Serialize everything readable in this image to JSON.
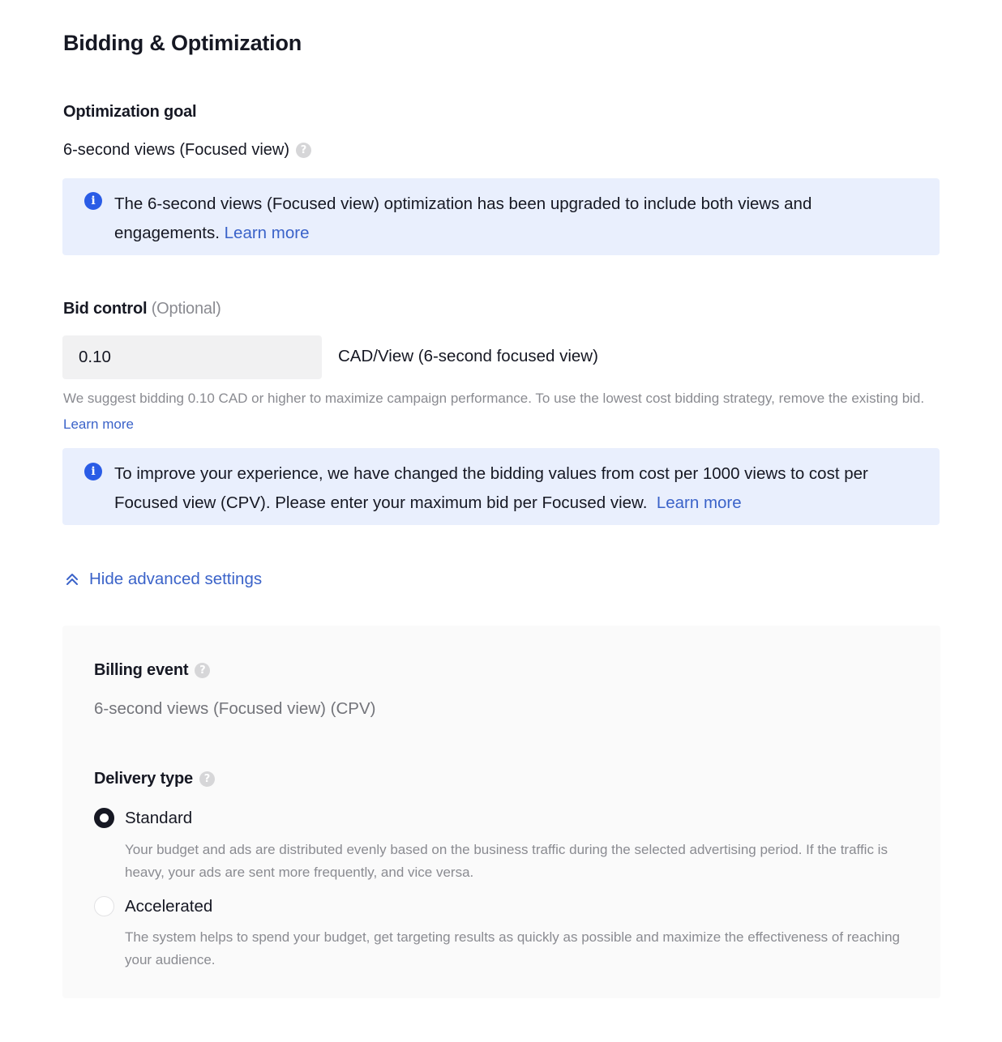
{
  "page": {
    "title": "Bidding & Optimization"
  },
  "optimization_goal": {
    "label": "Optimization goal",
    "value": "6-second views (Focused view)",
    "help_icon": "question-circle-icon",
    "info": {
      "icon": "info-circle-icon",
      "text": "The 6-second views (Focused view) optimization has been upgraded to include both views and engagements.",
      "link": "Learn more"
    }
  },
  "bid_control": {
    "label": "Bid control",
    "optional": "(Optional)",
    "input_value": "0.10",
    "unit": "CAD/View (6-second focused view)",
    "hint_text": "We suggest bidding 0.10 CAD or higher to maximize campaign performance. To use the lowest cost bidding strategy, remove the existing bid.",
    "hint_link": "Learn more",
    "info": {
      "icon": "info-circle-icon",
      "text": "To improve your experience, we have changed the bidding values from cost per 1000 views to cost per Focused view (CPV). Please enter your maximum bid per Focused view.",
      "link": "Learn more"
    }
  },
  "advanced_toggle": {
    "icon": "double-chevron-up-icon",
    "label": "Hide advanced settings"
  },
  "billing_event": {
    "label": "Billing event",
    "help_icon": "question-circle-icon",
    "value": "6-second views (Focused view) (CPV)"
  },
  "delivery_type": {
    "label": "Delivery type",
    "help_icon": "question-circle-icon",
    "options": [
      {
        "label": "Standard",
        "selected": true,
        "description": "Your budget and ads are distributed evenly based on the business traffic during the selected advertising period. If the traffic is heavy, your ads are sent more frequently, and vice versa."
      },
      {
        "label": "Accelerated",
        "selected": false,
        "description": "The system helps to spend your budget, get targeting results as quickly as possible and maximize the effectiveness of reaching your audience."
      }
    ]
  },
  "colors": {
    "accent_link": "#3b63c9",
    "info_bg": "#e9effd",
    "info_icon": "#2a5ce6",
    "panel_bg": "#fafafa"
  }
}
